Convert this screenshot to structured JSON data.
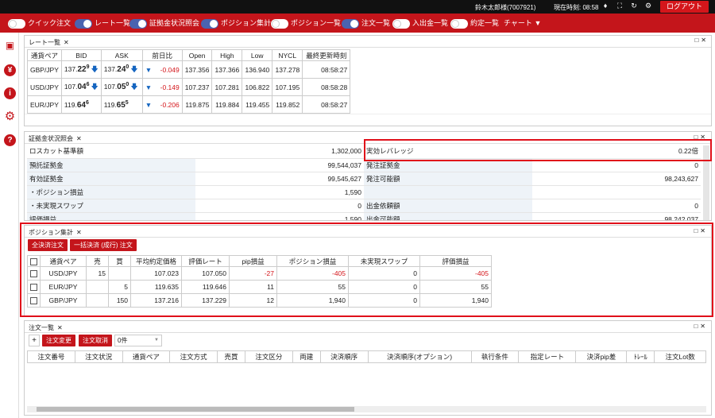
{
  "topbar": {
    "user": "鈴木太郎様(7007921)",
    "time": "現在時刻: 08:58",
    "logout": "ログアウト"
  },
  "menu": [
    {
      "label": "クイック注文",
      "on": false
    },
    {
      "label": "レート一覧",
      "on": true
    },
    {
      "label": "証拠金状況照会",
      "on": true
    },
    {
      "label": "ポジション集計",
      "on": true
    },
    {
      "label": "ポジション一覧",
      "on": false
    },
    {
      "label": "注文一覧",
      "on": true
    },
    {
      "label": "入出金一覧",
      "on": false
    },
    {
      "label": "約定一覧",
      "on": false
    }
  ],
  "menu_chart": "チャート",
  "rates": {
    "title": "レート一覧",
    "headers": [
      "通貨ペア",
      "BID",
      "ASK",
      "前日比",
      "Open",
      "High",
      "Low",
      "NYCL",
      "最終更新時刻"
    ],
    "rows": [
      {
        "pair": "GBP/JPY",
        "bid_a": "137.",
        "bid_b": "22",
        "bid_c": "9",
        "ask_a": "137.",
        "ask_b": "24",
        "ask_c": "0",
        "chg": "-0.049",
        "open": "137.356",
        "high": "137.366",
        "low": "136.940",
        "nycl": "137.278",
        "time": "08:58:27"
      },
      {
        "pair": "USD/JPY",
        "bid_a": "107.",
        "bid_b": "04",
        "bid_c": "6",
        "ask_a": "107.",
        "ask_b": "05",
        "ask_c": "0",
        "chg": "-0.149",
        "open": "107.237",
        "high": "107.281",
        "low": "106.822",
        "nycl": "107.195",
        "time": "08:58:28"
      },
      {
        "pair": "EUR/JPY",
        "bid_a": "119.",
        "bid_b": "64",
        "bid_c": "6",
        "ask_a": "119.",
        "ask_b": "65",
        "ask_c": "5",
        "chg": "-0.206",
        "open": "119.875",
        "high": "119.884",
        "low": "119.455",
        "nycl": "119.852",
        "time": "08:58:27"
      }
    ]
  },
  "margin": {
    "title": "証拠金状況照会",
    "rows": [
      {
        "l": "ロスカット基準額",
        "v": "1,302,000",
        "l2": "実効レバレッジ",
        "v2": "0.22倍"
      },
      {
        "l": "預託証拠金",
        "v": "99,544,037",
        "l2": "発注証拠金",
        "v2": "0"
      },
      {
        "l": "有効証拠金",
        "v": "99,545,627",
        "l2": "発注可能額",
        "v2": "98,243,627"
      },
      {
        "l": "・ポジション損益",
        "v": "1,590",
        "l2": "",
        "v2": ""
      },
      {
        "l": "・未実現スワップ",
        "v": "0",
        "l2": "出金依頼額",
        "v2": "0"
      },
      {
        "l": "評価損益",
        "v": "1,590",
        "l2": "出金可能額",
        "v2": "98,242,037"
      }
    ]
  },
  "positions": {
    "title": "ポジション集計",
    "btn1": "全決済注文",
    "btn2": "一括決済 (成行) 注文",
    "headers": [
      "通貨ペア",
      "売",
      "買",
      "平均約定価格",
      "評価レート",
      "pip損益",
      "ポジション損益",
      "未実現スワップ",
      "評価損益"
    ],
    "rows": [
      {
        "pair": "USD/JPY",
        "sell": "15",
        "buy": "",
        "avg": "107.023",
        "rate": "107.050",
        "pip": "-27",
        "pl": "-405",
        "swap": "0",
        "eval": "-405"
      },
      {
        "pair": "EUR/JPY",
        "sell": "",
        "buy": "5",
        "avg": "119.635",
        "rate": "119.646",
        "pip": "11",
        "pl": "55",
        "swap": "0",
        "eval": "55"
      },
      {
        "pair": "GBP/JPY",
        "sell": "",
        "buy": "150",
        "avg": "137.216",
        "rate": "137.229",
        "pip": "12",
        "pl": "1,940",
        "swap": "0",
        "eval": "1,940"
      }
    ]
  },
  "orders": {
    "title": "注文一覧",
    "plus": "+",
    "btn1": "注文変更",
    "btn2": "注文取消",
    "count": "0件",
    "headers": [
      "注文番号",
      "注文状況",
      "通貨ペア",
      "注文方式",
      "売買",
      "注文区分",
      "両建",
      "決済順序",
      "決済順序(オプション)",
      "執行条件",
      "指定レート",
      "決済pip差",
      "ﾄﾚｰﾙ",
      "注文Lot数"
    ]
  },
  "colors": {
    "brand": "#c4151b",
    "highlight": "#e0101a",
    "negative": "#d4161b",
    "arrow": "#1565c0"
  }
}
